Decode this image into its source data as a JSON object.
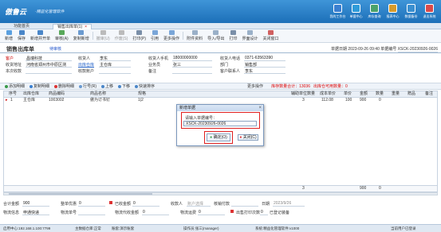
{
  "app": {
    "logo": "傲鲁云",
    "subtitle": "·精益化管理软件"
  },
  "topnav": [
    {
      "label": "我的工作台",
      "color": "#3a7fd0"
    },
    {
      "label": "单据中心",
      "color": "#2f9bd9"
    },
    {
      "label": "库存查询",
      "color": "#4aa26a"
    },
    {
      "label": "报表中心",
      "color": "#d79b2b"
    },
    {
      "label": "数据备份",
      "color": "#3a8fd0"
    },
    {
      "label": "退出系统",
      "color": "#d94a4a"
    }
  ],
  "tabs": {
    "home": "功能首页",
    "active": "销售出库单(1)",
    "close": "×"
  },
  "toolbar": [
    "新增",
    "保存",
    "新增并开单",
    "审核(A)",
    "复制新增",
    "撤审(U)",
    "作废(S)",
    "打印(P)",
    "引用",
    "更多操作",
    "附件资料",
    "导入/导出",
    "打印",
    "界面设计",
    "关闭窗口"
  ],
  "doc": {
    "title": "销售出库单",
    "status": "待审核",
    "date_label": "单据日期",
    "date": "2023-09-26 09:40",
    "no_label": "单据编号",
    "no": "XSCK-20230926-0026"
  },
  "form": {
    "customer_label": "客户",
    "customer": "昌瑞科技",
    "receiver_label": "收货人",
    "receiver": "李东",
    "phone_label": "收货人手机",
    "phone": "18000000000",
    "tel_label": "收货人电话",
    "tel": "0371-63563390",
    "addr_label": "收货地址",
    "addr": "河南省郑州市中原区测",
    "warehouse_label": "出库仓库",
    "warehouse": "主仓库",
    "staff_label": "业务员",
    "staff": "张三",
    "dept_label": "部门",
    "dept": "销售部",
    "due_label": "本次收款",
    "due": "",
    "account_label": "收款账户",
    "account": "",
    "remark_label": "备注",
    "remark": "",
    "contact_label": "客户联系人",
    "contact": "李东"
  },
  "gridbar": {
    "buttons": [
      "添加明细",
      "复制明细",
      "删除明细",
      "行号(R)",
      "上移",
      "下移",
      "快速排序",
      "更多操作"
    ],
    "stock_label": "库存数量合计：",
    "stock": "13036",
    "usable_label": "出库仓可用数量：",
    "usable": "0"
  },
  "grid": {
    "headers": [
      "序号",
      "出库仓库",
      "商品编码",
      "商品名称",
      "规格",
      "单位",
      "辅助单位数量",
      "成本单价",
      "单价",
      "金额",
      "数量",
      "重量",
      "赠品",
      "备注"
    ],
    "row": [
      "1",
      "主仓库",
      "1003002",
      "傲为订书钉",
      "",
      "1|2",
      "3",
      "112.08",
      "100",
      "900",
      "0",
      ""
    ],
    "totals": {
      "qty": "3",
      "amount": "900",
      "count": "0"
    }
  },
  "footer": {
    "total_label": "合计金额",
    "total": "900",
    "discount_label": "整单优惠",
    "discount": "0",
    "paid_label": "已收金额",
    "paid": "0",
    "account_label": "收款人",
    "account": "账户选择",
    "pay_label": "核销付款",
    "pay": "",
    "date_label": "日期",
    "date": "2023/9/26",
    "ship_label": "物流信息",
    "ship": "申通快递",
    "ship_no_label": "物流单号",
    "ship_no": "",
    "ship_fee_label": "物流代收金额",
    "ship_fee": "0",
    "fee_label": "物流运费",
    "fee": "0",
    "print_label": "出售打印次数",
    "print": "0",
    "remain_label": "已登记装备",
    "check_label": "积分"
  },
  "statusbar": {
    "a": "启用中心:192.168.1.100:7799",
    "b": "主数据仓库:正常",
    "c": "账套:演示账套",
    "d": "操作员:张三(manager)",
    "e": "系统:精益化管理软件:v1000",
    "f": "当前用户已登录"
  },
  "dialog": {
    "title": "新增单据",
    "label": "请输入单据编号：",
    "value": "XSCK-20230926-0026",
    "ok": "确定(O)",
    "cancel": "关闭(C)"
  }
}
